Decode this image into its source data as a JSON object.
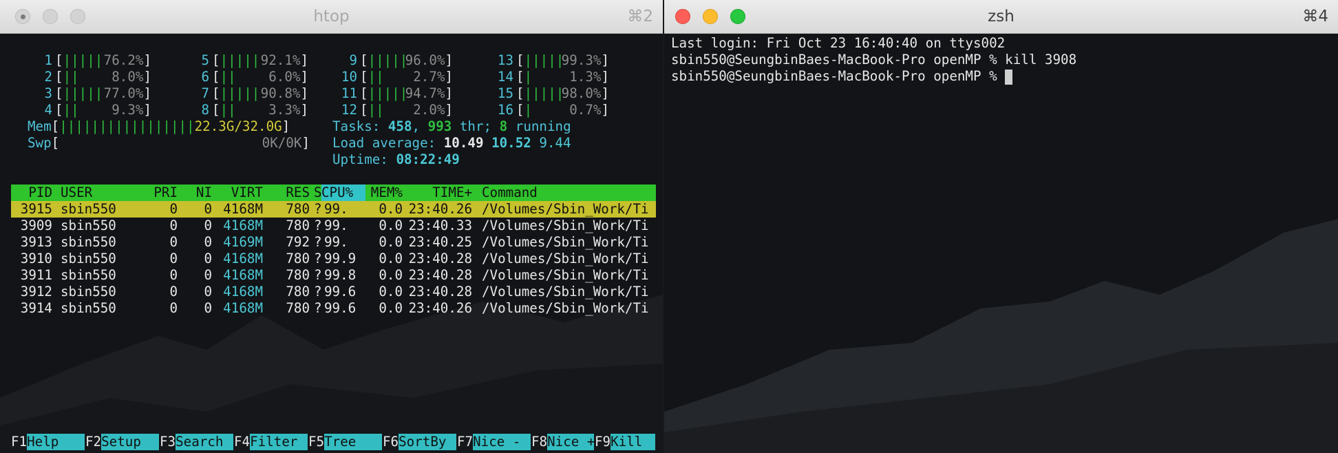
{
  "htop_window": {
    "title": "htop",
    "shortcut": "⌘2",
    "cpus": [
      {
        "id": "1",
        "bar": "|||||",
        "value": "76.2%"
      },
      {
        "id": "2",
        "bar": "||",
        "value": "8.0%"
      },
      {
        "id": "3",
        "bar": "|||||",
        "value": "77.0%"
      },
      {
        "id": "4",
        "bar": "||",
        "value": "9.3%"
      },
      {
        "id": "5",
        "bar": "|||||",
        "value": "92.1%"
      },
      {
        "id": "6",
        "bar": "||",
        "value": "6.0%"
      },
      {
        "id": "7",
        "bar": "|||||",
        "value": "90.8%"
      },
      {
        "id": "8",
        "bar": "||",
        "value": "3.3%"
      },
      {
        "id": "9",
        "bar": "|||||",
        "value": "96.0%"
      },
      {
        "id": "10",
        "bar": "||",
        "value": "2.7%"
      },
      {
        "id": "11",
        "bar": "|||||",
        "value": "94.7%"
      },
      {
        "id": "12",
        "bar": "||",
        "value": "2.0%"
      },
      {
        "id": "13",
        "bar": "|||||",
        "value": "99.3%"
      },
      {
        "id": "14",
        "bar": "|",
        "value": "1.3%"
      },
      {
        "id": "15",
        "bar": "|||||",
        "value": "98.0%"
      },
      {
        "id": "16",
        "bar": "|",
        "value": "0.7%"
      }
    ],
    "mem": {
      "label": "Mem",
      "bar": "|||||||||||||||||",
      "value": "22.3G/32.0G"
    },
    "swp": {
      "label": "Swp",
      "value": "0K/0K"
    },
    "tasks": {
      "label": "Tasks:",
      "count": "458",
      "threads": "993",
      "threads_label": "thr;",
      "running": "8",
      "running_label": "running"
    },
    "load": {
      "label": "Load average:",
      "l1": "10.49",
      "l5": "10.52",
      "l15": "9.44"
    },
    "uptime": {
      "label": "Uptime:",
      "value": "08:22:49"
    },
    "columns": [
      "PID",
      "USER",
      "PRI",
      "NI",
      "VIRT",
      "RES",
      "S",
      "CPU%",
      "MEM%",
      "TIME+",
      "Command"
    ],
    "processes": [
      {
        "pid": "3915",
        "user": "sbin550",
        "pri": "0",
        "ni": "0",
        "virt": "4168M",
        "res": "780",
        "s": "?",
        "cpu": "99.",
        "mem": "0.0",
        "time": "23:40.26",
        "cmd": "/Volumes/Sbin_Work/Ti"
      },
      {
        "pid": "3909",
        "user": "sbin550",
        "pri": "0",
        "ni": "0",
        "virt": "4168M",
        "res": "780",
        "s": "?",
        "cpu": "99.",
        "mem": "0.0",
        "time": "23:40.33",
        "cmd": "/Volumes/Sbin_Work/Ti"
      },
      {
        "pid": "3913",
        "user": "sbin550",
        "pri": "0",
        "ni": "0",
        "virt": "4169M",
        "res": "792",
        "s": "?",
        "cpu": "99.",
        "mem": "0.0",
        "time": "23:40.25",
        "cmd": "/Volumes/Sbin_Work/Ti"
      },
      {
        "pid": "3910",
        "user": "sbin550",
        "pri": "0",
        "ni": "0",
        "virt": "4168M",
        "res": "780",
        "s": "?",
        "cpu": "99.9",
        "mem": "0.0",
        "time": "23:40.28",
        "cmd": "/Volumes/Sbin_Work/Ti"
      },
      {
        "pid": "3911",
        "user": "sbin550",
        "pri": "0",
        "ni": "0",
        "virt": "4168M",
        "res": "780",
        "s": "?",
        "cpu": "99.8",
        "mem": "0.0",
        "time": "23:40.28",
        "cmd": "/Volumes/Sbin_Work/Ti"
      },
      {
        "pid": "3912",
        "user": "sbin550",
        "pri": "0",
        "ni": "0",
        "virt": "4168M",
        "res": "780",
        "s": "?",
        "cpu": "99.6",
        "mem": "0.0",
        "time": "23:40.28",
        "cmd": "/Volumes/Sbin_Work/Ti"
      },
      {
        "pid": "3914",
        "user": "sbin550",
        "pri": "0",
        "ni": "0",
        "virt": "4168M",
        "res": "780",
        "s": "?",
        "cpu": "99.6",
        "mem": "0.0",
        "time": "23:40.26",
        "cmd": "/Volumes/Sbin_Work/Ti"
      }
    ],
    "function_keys": [
      {
        "key": "F1",
        "label": "Help"
      },
      {
        "key": "F2",
        "label": "Setup"
      },
      {
        "key": "F3",
        "label": "Search"
      },
      {
        "key": "F4",
        "label": "Filter"
      },
      {
        "key": "F5",
        "label": "Tree"
      },
      {
        "key": "F6",
        "label": "SortBy"
      },
      {
        "key": "F7",
        "label": "Nice -"
      },
      {
        "key": "F8",
        "label": "Nice +"
      },
      {
        "key": "F9",
        "label": "Kill"
      }
    ]
  },
  "zsh_window": {
    "title": "zsh",
    "shortcut": "⌘4",
    "lines": [
      "Last login: Fri Oct 23 16:40:40 on ttys002",
      "sbin550@SeungbinBaes-MacBook-Pro openMP % kill 3908",
      "sbin550@SeungbinBaes-MacBook-Pro openMP % "
    ]
  }
}
